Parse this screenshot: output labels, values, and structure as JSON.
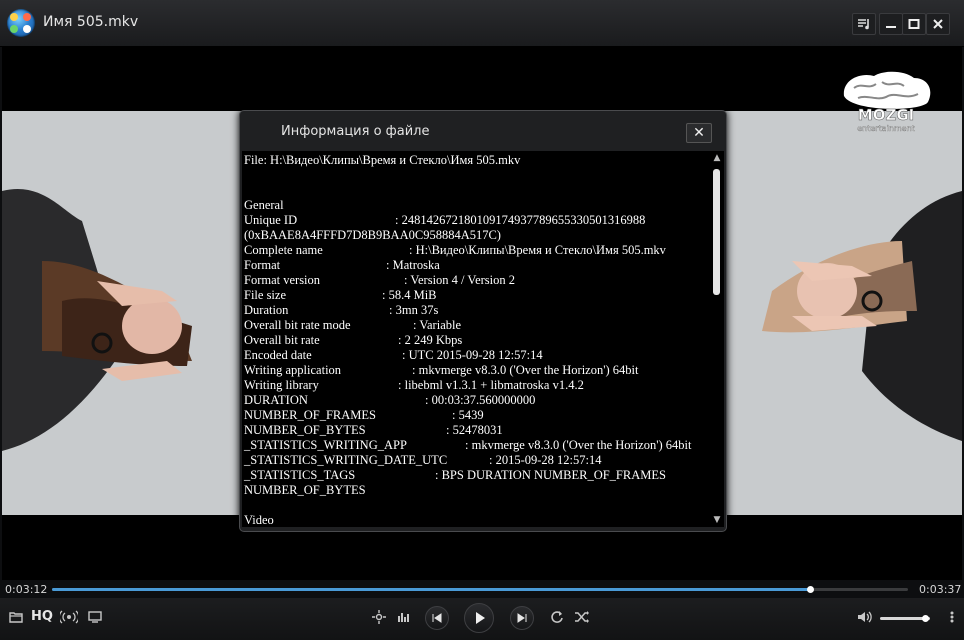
{
  "window": {
    "title": "Имя 505.mkv",
    "accent_color": "#4a9ad6"
  },
  "dialog": {
    "title": "Информация о файле",
    "close_label": "✕",
    "file_line": "File:  H:\\Видео\\Клипы\\Время и Стекло\\Имя 505.mkv",
    "section_general": "General",
    "unique_id_label": "Unique ID",
    "unique_id_value": ": 248142672180109174937789655330501316988",
    "unique_id_hex": "(0xBAAE8A4FFFD7D8B9BAA0C958884A517C)",
    "fields": [
      {
        "label": "Complete name",
        "value": ": H:\\Видео\\Клипы\\Время и Стекло\\Имя 505.mkv"
      },
      {
        "label": "Format",
        "value": ": Matroska"
      },
      {
        "label": "Format version",
        "value": ": Version 4 / Version 2"
      },
      {
        "label": "File size",
        "value": ": 58.4 MiB"
      },
      {
        "label": "Duration",
        "value": ": 3mn 37s"
      },
      {
        "label": "Overall bit rate mode",
        "value": ": Variable"
      },
      {
        "label": "Overall bit rate",
        "value": ": 2 249 Kbps"
      },
      {
        "label": "Encoded date",
        "value": ": UTC 2015-09-28 12:57:14"
      },
      {
        "label": "Writing application",
        "value": ": mkvmerge v8.3.0 ('Over the Horizon') 64bit"
      },
      {
        "label": "Writing library",
        "value": ": libebml v1.3.1 + libmatroska v1.4.2"
      },
      {
        "label": "DURATION",
        "value": ": 00:03:37.560000000"
      },
      {
        "label": "NUMBER_OF_FRAMES",
        "value": ": 5439"
      },
      {
        "label": "NUMBER_OF_BYTES",
        "value": ": 52478031"
      },
      {
        "label": "_STATISTICS_WRITING_APP",
        "value": ": mkvmerge v8.3.0 ('Over the Horizon') 64bit"
      },
      {
        "label": "_STATISTICS_WRITING_DATE_UTC",
        "value": ": 2015-09-28 12:57:14"
      },
      {
        "label": "_STATISTICS_TAGS",
        "value": ": BPS DURATION NUMBER_OF_FRAMES"
      }
    ],
    "tags_continuation": "NUMBER_OF_BYTES",
    "section_video": "Video"
  },
  "watermark": {
    "text_top": "MOZGI",
    "text_bottom": "entertainment"
  },
  "player": {
    "time_current": "0:03:12",
    "time_total": "0:03:37",
    "progress_fraction": 0.885,
    "volume_fraction": 0.9,
    "hq_label": "HQ"
  }
}
